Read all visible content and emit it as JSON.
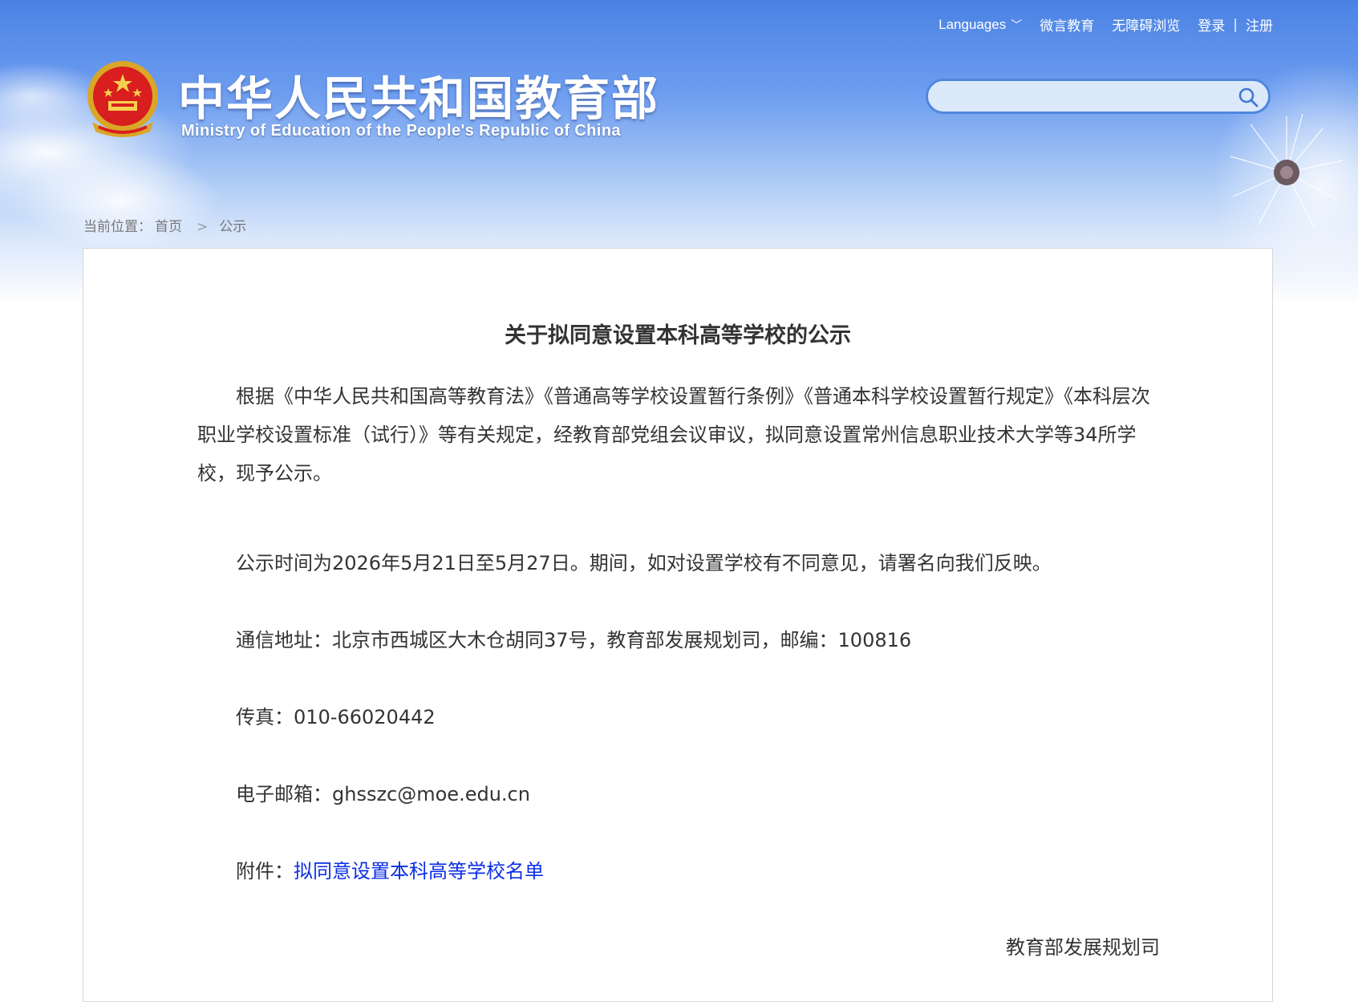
{
  "header": {
    "nav": {
      "languages": "Languages",
      "weiyan": "微言教育",
      "accessible": "无障碍浏览",
      "login": "登录",
      "register": "注册"
    },
    "site_title": "中华人民共和国教育部",
    "site_subtitle": "Ministry of Education of the People's Republic of China",
    "search": {
      "value": ""
    }
  },
  "breadcrumb": {
    "prefix": "当前位置：",
    "home": "首页",
    "separator": ">",
    "current": "公示"
  },
  "article": {
    "title": "关于拟同意设置本科高等学校的公示",
    "paragraph1": "根据《中华人民共和国高等教育法》《普通高等学校设置暂行条例》《普通本科学校设置暂行规定》《本科层次职业学校设置标准（试行）》等有关规定，经教育部党组会议审议，拟同意设置常州信息职业技术大学等34所学校，现予公示。",
    "paragraph2": "公示时间为2026年5月21日至5月27日。期间，如对设置学校有不同意见，请署名向我们反映。",
    "address": "通信地址：北京市西城区大木仓胡同37号，教育部发展规划司，邮编：100816",
    "fax": "传真：010-66020442",
    "email": "电子邮箱：ghsszc@moe.edu.cn",
    "attachment_label": "附件：",
    "attachment_link": "拟同意设置本科高等学校名单",
    "signature": "教育部发展规划司"
  },
  "colors": {
    "link": "#0b2ee6",
    "text": "#333333",
    "sky_top": "#4a82e4",
    "search_border": "#4f86df"
  }
}
